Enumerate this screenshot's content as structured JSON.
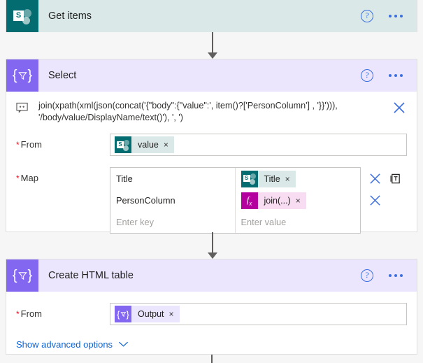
{
  "flow": {
    "steps": [
      {
        "id": "get-items",
        "title": "Get items",
        "icon": "sharepoint-icon",
        "icon_letter": "S",
        "header_bg": "#dae9e8",
        "icon_bg": "#036c70",
        "help_label": "?",
        "more_label": "..."
      },
      {
        "id": "select",
        "title": "Select",
        "icon": "data-operation-icon",
        "header_bg": "#ebe6fd",
        "icon_bg": "#8367f0",
        "help_label": "?",
        "more_label": "...",
        "expression": {
          "icon": "expression-tooltip-icon",
          "text": "join(xpath(xml(json(concat('{\"body\":{\"value\":', item()?['PersonColumn'] , '}}'))), '/body/value/DisplayName/text()'), ', ')",
          "close_label": "×"
        },
        "from": {
          "label": "From",
          "required": true,
          "token": {
            "label": "value",
            "icon": "sharepoint-icon",
            "icon_letter": "S",
            "icon_bg": "#036c70",
            "chip_bg": "#dae9e8",
            "remove_label": "×"
          }
        },
        "map": {
          "label": "Map",
          "required": true,
          "rows": [
            {
              "key": "Title",
              "key_placeholder": "",
              "value_token": {
                "label": "Title",
                "icon": "sharepoint-icon",
                "icon_letter": "S",
                "icon_bg": "#036c70",
                "chip_bg": "#dae9e8",
                "remove_label": "×"
              },
              "actions": [
                "delete-row-icon",
                "switch-to-text-mode-icon"
              ]
            },
            {
              "key": "PersonColumn",
              "key_placeholder": "",
              "value_token": {
                "label": "join(...)",
                "icon": "expression-fx-icon",
                "icon_letter": "fx",
                "icon_bg": "#b4009e",
                "chip_bg": "#f7dcf2",
                "remove_label": "×"
              },
              "actions": [
                "delete-row-icon"
              ]
            },
            {
              "key": "",
              "key_placeholder": "Enter key",
              "value_placeholder": "Enter value",
              "actions": []
            }
          ]
        }
      },
      {
        "id": "create-html-table",
        "title": "Create HTML table",
        "icon": "data-operation-icon",
        "header_bg": "#ebe6fd",
        "icon_bg": "#8367f0",
        "help_label": "?",
        "more_label": "...",
        "from": {
          "label": "From",
          "required": true,
          "token": {
            "label": "Output",
            "icon": "data-operation-icon",
            "icon_bg": "#8367f0",
            "chip_bg": "#ebe6fd",
            "remove_label": "×"
          }
        },
        "advanced_options": {
          "label": "Show advanced options",
          "chevron": "chevron-down-icon"
        }
      }
    ]
  },
  "colors": {
    "sharepoint_teal": "#036c70",
    "sharepoint_header": "#dae9e8",
    "dataop_purple": "#8367f0",
    "dataop_header": "#ebe6fd",
    "expression_magenta": "#b4009e",
    "link_blue": "#0b64d6",
    "connector_gray": "#605e5c",
    "required_red": "#e81123"
  }
}
